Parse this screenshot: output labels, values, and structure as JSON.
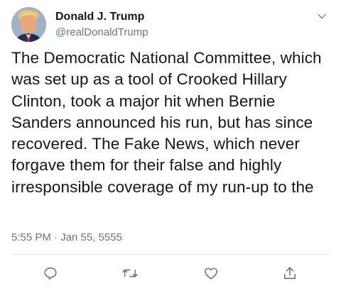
{
  "author": {
    "display_name": "Donald J. Trump",
    "handle": "@realDonaldTrump",
    "avatar_icon": "profile-photo"
  },
  "tweet": {
    "text": "The Democratic National Committee, which was set up as a tool of Crooked Hillary Clinton, took a major hit when Bernie Sanders announced his run, but has since recovered. The Fake News, which never forgave them for their false and highly irresponsible coverage of my run-up to the",
    "timestamp": "5:55 PM · Jan 55, 5555"
  },
  "actions": {
    "reply_icon": "reply-icon",
    "retweet_icon": "retweet-icon",
    "like_icon": "heart-icon",
    "share_icon": "share-icon"
  },
  "colors": {
    "text_primary": "#14171a",
    "text_secondary": "#657786",
    "divider": "#e1e8ed"
  }
}
